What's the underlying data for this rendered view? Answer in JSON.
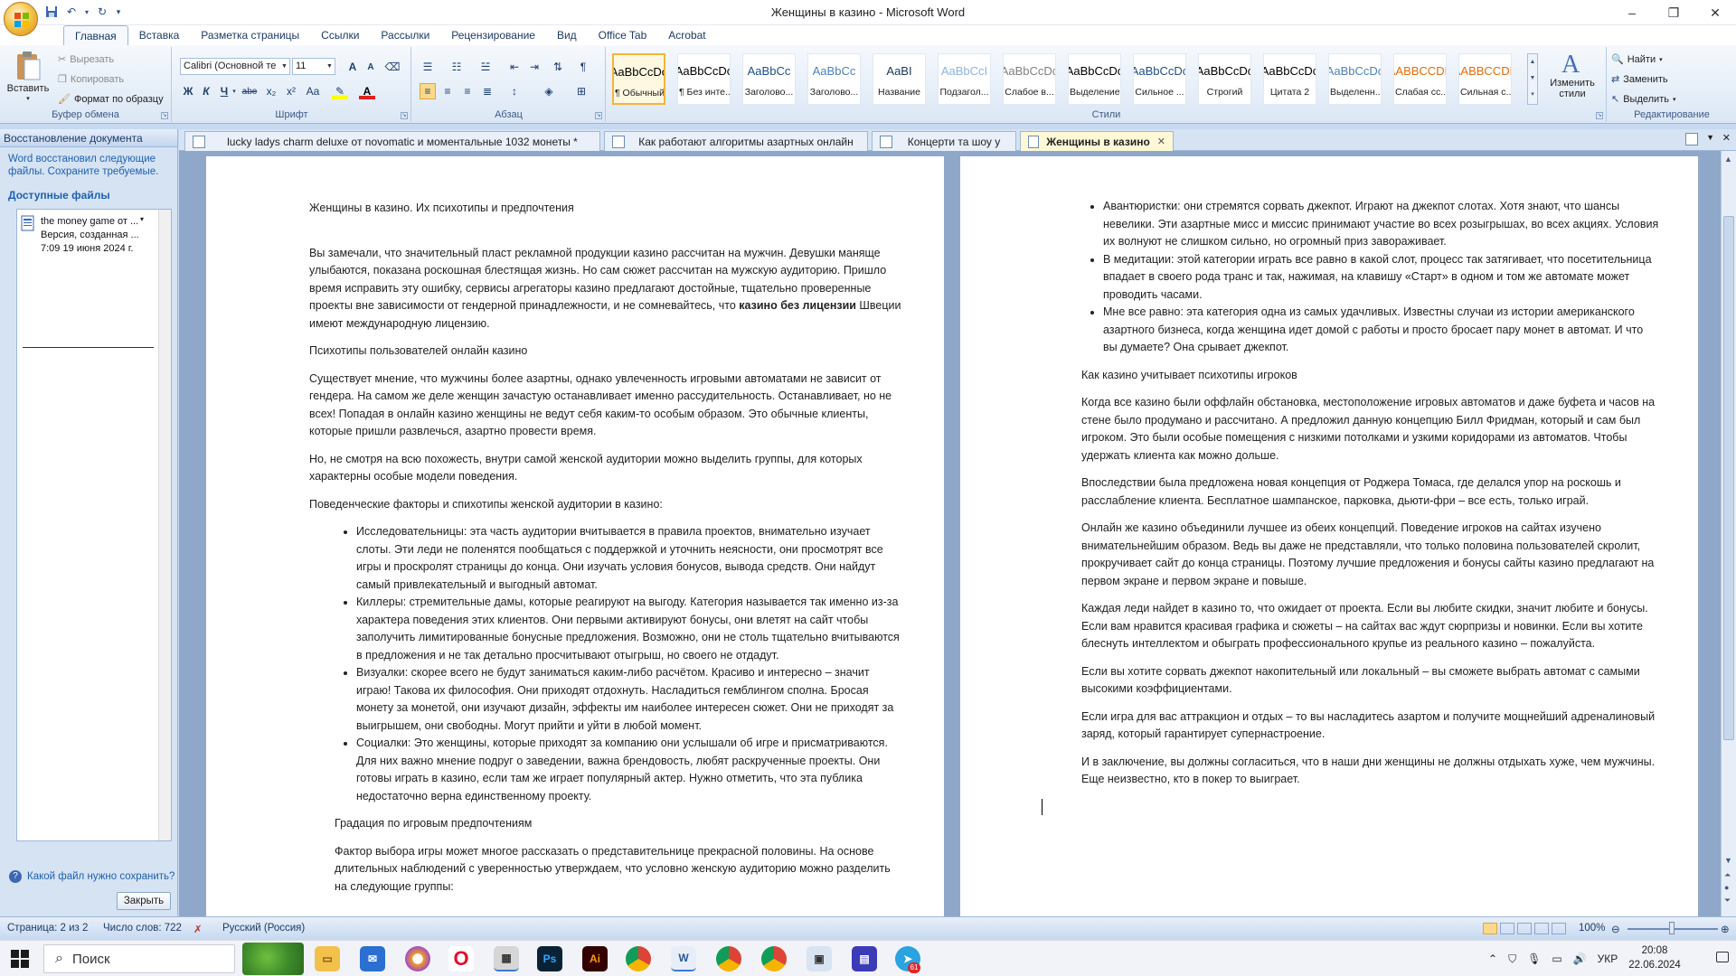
{
  "window": {
    "title": "Женщины в казино - Microsoft Word",
    "controls": [
      "–",
      "❐",
      "✕"
    ]
  },
  "tabs": [
    "Главная",
    "Вставка",
    "Разметка страницы",
    "Ссылки",
    "Рассылки",
    "Рецензирование",
    "Вид",
    "Office Tab",
    "Acrobat"
  ],
  "ribbon": {
    "clipboard": {
      "label": "Буфер обмена",
      "paste": "Вставить",
      "cut": "Вырезать",
      "copy": "Копировать",
      "format_painter": "Формат по образцу"
    },
    "font": {
      "label": "Шрифт",
      "font_name": "Calibri (Основной те",
      "font_size": "11",
      "bold": "Ж",
      "italic": "К",
      "underline": "Ч",
      "strike": "abe",
      "sub": "x₂",
      "sup": "x²",
      "case": "Aa",
      "grow": "A",
      "shrink": "A"
    },
    "paragraph": {
      "label": "Абзац"
    },
    "styles": {
      "label": "Стили",
      "items": [
        {
          "sample": "AaBbCcDc",
          "name": "¶ Обычный",
          "color": "#000000",
          "selected": true
        },
        {
          "sample": "AaBbCcDc",
          "name": "¶ Без инте...",
          "color": "#000000",
          "selected": false
        },
        {
          "sample": "AaBbCc",
          "name": "Заголово...",
          "color": "#1f4e8c",
          "selected": false
        },
        {
          "sample": "AaBbCc",
          "name": "Заголово...",
          "color": "#4f81bd",
          "selected": false
        },
        {
          "sample": "AaBI",
          "name": "Название",
          "color": "#17365d",
          "selected": false
        },
        {
          "sample": "AaBbCcI",
          "name": "Подзагол...",
          "color": "#8db3e2",
          "selected": false
        },
        {
          "sample": "AaBbCcDc",
          "name": "Слабое в...",
          "color": "#808080",
          "selected": false
        },
        {
          "sample": "AaBbCcDc",
          "name": "Выделение",
          "color": "#000000",
          "selected": false
        },
        {
          "sample": "AaBbCcDc",
          "name": "Сильное ...",
          "color": "#1f4e8c",
          "selected": false
        },
        {
          "sample": "AaBbCcDc",
          "name": "Строгий",
          "color": "#000000",
          "selected": false
        },
        {
          "sample": "AaBbCcDc",
          "name": "Цитата 2",
          "color": "#000000",
          "selected": false
        },
        {
          "sample": "AaBbCcDc",
          "name": "Выделенн...",
          "color": "#4f81bd",
          "selected": false
        },
        {
          "sample": "AABBCCDE",
          "name": "Слабая сс...",
          "color": "#e36c0a",
          "selected": false
        },
        {
          "sample": "AABBCCDE",
          "name": "Сильная с...",
          "color": "#e36c0a",
          "selected": false
        }
      ],
      "change": "Изменить стили"
    },
    "editing": {
      "label": "Редактирование",
      "find": "Найти",
      "replace": "Заменить",
      "select": "Выделить"
    }
  },
  "recovery_pane": {
    "title": "Восстановление документа",
    "message": "Word восстановил следующие файлы.  Сохраните требуемые.",
    "available": "Доступные файлы",
    "file": {
      "line1": "the money game от ...",
      "line2": "Версия, созданная ...",
      "line3": "7:09 19 июня 2024 г."
    },
    "help": "Какой файл нужно сохранить?",
    "close": "Закрыть"
  },
  "doc_tabs": [
    {
      "label": "lucky ladys charm deluxe от novomatic  и моментальные 1032 монеты *",
      "active": false
    },
    {
      "label": "Как работают алгоритмы азартных онлайн",
      "active": false
    },
    {
      "label": "Концерти та шоу у",
      "active": false
    },
    {
      "label": "Женщины в казино",
      "active": true
    }
  ],
  "page1": {
    "title": "Женщины в казино. Их психотипы и предпочтения",
    "p1a": "Вы замечали, что значительный пласт рекламной продукции казино рассчитан на мужчин. Девушки маняще улыбаются, показана роскошная блестящая жизнь. Но сам сюжет рассчитан на мужскую аудиторию. Пришло время исправить эту ошибку, сервисы агрегаторы казино предлагают достойные, тщательно проверенные проекты вне зависимости от гендерной принадлежности, и не сомневайтесь, что ",
    "p1b": "казино без лицензии",
    "p1c": " Швеции имеют международную лицензию.",
    "h2": "Психотипы пользователей онлайн казино",
    "p2": "Существует мнение, что мужчины более азартны, однако увлеченность игровыми автоматами не зависит от гендера.  На самом же деле женщин зачастую останавливает именно рассудительность. Останавливает, но не всех! Попадая в онлайн казино женщины не ведут себя каким-то особым образом. Это обычные клиенты, которые пришли развлечься, азартно провести время.",
    "p3": "Но, не смотря на всю похожесть, внутри самой женской аудитории можно выделить группы, для которых характерны особые модели поведения.",
    "h3": "Поведенческие факторы и спихотипы женской аудитории в казино:",
    "li1": "Исследовательницы: эта часть аудитории вчитывается в правила проектов, внимательно изучает слоты. Эти леди не поленятся пообщаться с поддержкой и уточнить неясности, они просмотрят все игры и проскролят страницы до конца. Они изучать условия бонусов, вывода средств. Они найдут самый привлекательный и выгодный автомат.",
    "li2": "Киллеры: стремительные дамы, которые реагируют на выгоду. Категория называется так именно из-за характера поведения этих клиентов. Они первыми активируют бонусы, они влетят на сайт чтобы заполучить лимитированные бонусные предложения. Возможно, они не столь тщательно вчитываются в предложения и не так детально просчитывают отыгрыш, но своего не отдадут.",
    "li3": "Визуалки: скорее всего не будут заниматься каким-либо расчётом. Красиво и интересно – значит играю! Такова их философия. Они приходят отдохнуть. Насладиться гемблингом сполна. Бросая монету за монетой, они изучают дизайн, эффекты им наиболее интересен сюжет. Они не приходят за выигрышем, они свободны. Могут прийти и уйти в любой момент.",
    "li4": "Социалки: Это женщины, которые приходят за компанию они услышали об игре и присматриваются. Для них важно мнение подруг о заведении, важна брендовость, любят раскрученные проекты. Они готовы играть в казино, если там же играет популярный актер. Нужно отметить, что эта публика недостаточно верна единственному проекту.",
    "h4": "Градация по игровым предпочтениям",
    "p4": "Фактор выбора игры может многое рассказать о представительнице прекрасной половины. На основе длительных наблюдений с уверенностью утверждаем, что условно женскую аудиторию можно разделить на следующие группы:"
  },
  "page2": {
    "li1": "Авантюристки: они стремятся сорвать джекпот. Играют на джекпот слотах. Хотя знают, что шансы невелики. Эти азартные мисс и миссис принимают участие во всех розыгрышах, во всех акциях. Условия их волнуют не слишком сильно, но огромный приз завораживает.",
    "li2": "В медитации: этой категории играть все равно в какой слот, процесс так затягивает, что посетительница впадает в своего рода транс и так, нажимая, на клавишу «Старт» в одном и том же автомате может проводить часами.",
    "li3": "Мне все равно: эта категория одна из самых удачливых. Известны случаи из истории американского азартного бизнеса, когда женщина идет домой с работы и просто бросает пару монет в автомат. И что вы думаете? Она срывает джекпот.",
    "h1": "Как казино учитывает психотипы игроков",
    "p1": "Когда все казино были оффлайн обстановка, местоположение игровых автоматов и даже буфета и часов на стене было продумано и рассчитано.  А предложил данную концепцию Билл Фридман, который и сам был игроком. Это были особые помещения с низкими потолками и узкими коридорами из автоматов. Чтобы удержать клиента как можно дольше.",
    "p2": "Впоследствии была предложена новая концепция от Роджера Томаса, где делался упор на роскошь и расслабление клиента. Бесплатное шампанское, парковка, дьюти-фри – все есть, только играй.",
    "p3": "Онлайн же казино объединили лучшее из обеих концепций. Поведение игроков на сайтах изучено внимательнейшим образом. Ведь вы даже не представляли, что только половина пользователей скролит, прокручивает сайт до конца страницы. Поэтому лучшие предложения и бонусы сайты казино предлагают на первом экране и первом экране и повыше.",
    "p4": "Каждая леди найдет в казино то, что ожидает от проекта. Если вы  любите скидки, значит любите и бонусы. Если вам нравится красивая графика и сюжеты – на сайтах вас ждут сюрпризы и новинки. Если вы хотите блеснуть интеллектом и обыграть профессионального крупье из реального казино – пожалуйста.",
    "p5": "Если вы хотите сорвать джекпот накопительный или локальный – вы сможете выбрать автомат с самыми высокими коэффициентами.",
    "p6": "Если игра для вас аттракцион и отдых – то вы насладитесь азартом и получите мощнейший адреналиновый заряд, который гарантирует супернастроение.",
    "p7": "И в заключение, вы должны согласиться, что в наши дни женщины не должны отдыхать хуже, чем мужчины. Еще неизвестно, кто в покер то выиграет."
  },
  "status": {
    "page": "Страница: 2 из 2",
    "words": "Число слов: 722",
    "language": "Русский (Россия)",
    "zoom": "100%"
  },
  "taskbar": {
    "search": "Поиск",
    "lang": "УКР",
    "time": "20:08",
    "date": "22.06.2024",
    "badge": "61"
  }
}
